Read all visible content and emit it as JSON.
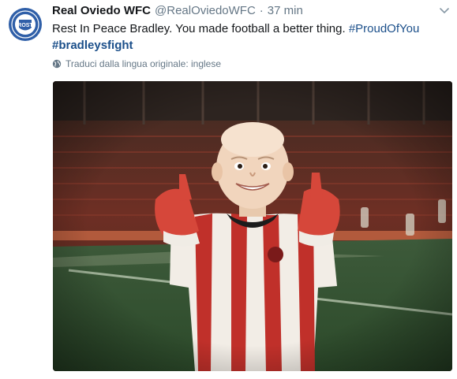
{
  "tweet": {
    "display_name": "Real Oviedo WFC",
    "handle": "@RealOviedoWFC",
    "separator": "·",
    "time": "37 min",
    "text_main": "Rest In Peace Bradley. You made football a better thing.",
    "hashtag1": "#ProudOfYou",
    "hashtag2": "#bradleysfight",
    "translate_label": "Traduci dalla lingua originale: inglese",
    "avatar_text": "ROST",
    "link_color": "#1b4f8a"
  },
  "icons": {
    "caret": "chevron-down-icon",
    "translate": "globe-icon"
  },
  "media": {
    "description_type": "photo"
  }
}
